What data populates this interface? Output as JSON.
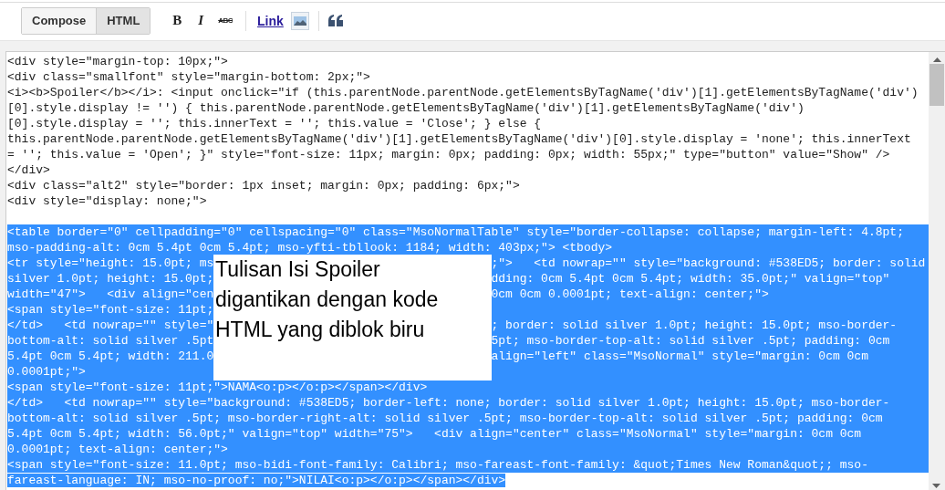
{
  "toolbar": {
    "mode_tabs": [
      {
        "label": "Compose",
        "selected": false
      },
      {
        "label": "HTML",
        "selected": true
      }
    ],
    "format_buttons": [
      {
        "label": "B",
        "kind": "bold"
      },
      {
        "label": "I",
        "kind": "italic"
      },
      {
        "label": "ABC",
        "kind": "strike"
      }
    ],
    "link": {
      "label": "Link"
    }
  },
  "editor": {
    "lines": [
      {
        "kind": "code",
        "text": "<div style=\"margin-top: 10px;\">",
        "selected": false
      },
      {
        "kind": "code",
        "text": "<div class=\"smallfont\" style=\"margin-bottom: 2px;\">",
        "selected": false
      },
      {
        "kind": "code",
        "text": "<i><b>Spoiler</b></i>: <input onclick=\"if (this.parentNode.parentNode.getElementsByTagName('div')[1].getElementsByTagName('div')",
        "selected": false
      },
      {
        "kind": "code",
        "text": "[0].style.display != '') { this.parentNode.parentNode.getElementsByTagName('div')[1].getElementsByTagName('div')",
        "selected": false
      },
      {
        "kind": "code",
        "text": "[0].style.display = ''; this.innerText = ''; this.value = 'Close'; } else {",
        "selected": false
      },
      {
        "kind": "code",
        "text": "this.parentNode.parentNode.getElementsByTagName('div')[1].getElementsByTagName('div')[0].style.display = 'none'; this.innerText",
        "selected": false
      },
      {
        "kind": "code",
        "text": "= ''; this.value = 'Open'; }\" style=\"font-size: 11px; margin: 0px; padding: 0px; width: 55px;\" type=\"button\" value=\"Show\" />",
        "selected": false
      },
      {
        "kind": "code",
        "text": "</div>",
        "selected": false
      },
      {
        "kind": "code",
        "text": "<div class=\"alt2\" style=\"border: 1px inset; margin: 0px; padding: 6px;\">",
        "selected": false
      },
      {
        "kind": "code",
        "text": "<div style=\"display: none;\">",
        "selected": false
      },
      {
        "kind": "blank"
      },
      {
        "kind": "code",
        "text": "<table border=\"0\" cellpadding=\"0\" cellspacing=\"0\" class=\"MsoNormalTable\" style=\"border-collapse: collapse; margin-left: 4.8pt;",
        "selected": true
      },
      {
        "kind": "code",
        "text": "mso-padding-alt: 0cm 5.4pt 0cm 5.4pt; mso-yfti-tbllook: 1184; width: 403px;\"> <tbody>",
        "selected": true
      },
      {
        "kind": "covered",
        "left": "<tr style=\"height: 15.0pt; ms",
        "right": ";\">   <td nowrap=\"\" style=\"background: #538ED5; border: solid",
        "selected": true
      },
      {
        "kind": "covered",
        "left": "silver 1.0pt; height: 15.0pt;",
        "right": "dding: 0cm 5.4pt 0cm 5.4pt; width: 35.0pt;\" valign=\"top\"",
        "selected": true
      },
      {
        "kind": "covered",
        "left": "width=\"47\">   <div align=\"cen",
        "right": "0cm 0cm 0.0001pt; text-align: center;\">",
        "selected": true
      },
      {
        "kind": "covered",
        "left": "<span style=\"font-size: 11pt;",
        "selected": true
      },
      {
        "kind": "covered",
        "left": "</td>   <td nowrap=\"\" style=\"",
        "right": "; border: solid silver 1.0pt; height: 15.0pt; mso-border-",
        "selected": true
      },
      {
        "kind": "covered",
        "left": "bottom-alt: solid silver .5pt",
        "right": "5pt; mso-border-top-alt: solid silver .5pt; padding: 0cm",
        "selected": true
      },
      {
        "kind": "covered",
        "left": "5.4pt 0cm 5.4pt; width: 211.0",
        "right": "align=\"left\" class=\"MsoNormal\" style=\"margin: 0cm 0cm",
        "selected": true
      },
      {
        "kind": "covered",
        "left": "0.0001pt;\">",
        "selected": true
      },
      {
        "kind": "code",
        "text": "<span style=\"font-size: 11pt;\">NAMA<o:p></o:p></span></div>",
        "selected": true
      },
      {
        "kind": "code",
        "text": "</td>   <td nowrap=\"\" style=\"background: #538ED5; border-left: none; border: solid silver 1.0pt; height: 15.0pt; mso-border-",
        "selected": true
      },
      {
        "kind": "code",
        "text": "bottom-alt: solid silver .5pt; mso-border-right-alt: solid silver .5pt; mso-border-top-alt: solid silver .5pt; padding: 0cm",
        "selected": true
      },
      {
        "kind": "code",
        "text": "5.4pt 0cm 5.4pt; width: 56.0pt;\" valign=\"top\" width=\"75\">   <div align=\"center\" class=\"MsoNormal\" style=\"margin: 0cm 0cm",
        "selected": true
      },
      {
        "kind": "code",
        "text": "0.0001pt; text-align: center;\">",
        "selected": true
      },
      {
        "kind": "code",
        "text": "<span style=\"font-size: 11.0pt; mso-bidi-font-family: Calibri; mso-fareast-font-family: &quot;Times New Roman&quot;; mso-",
        "selected": true
      },
      {
        "kind": "code",
        "text": "fareast-language: IN; mso-no-proof: no;\">NILAI<o:p></o:p></span></div>",
        "selected": true
      }
    ]
  },
  "overlay_note": {
    "lines": [
      "Tulisan Isi Spoiler",
      "digantikan dengan kode",
      "HTML yang diblok biru"
    ]
  }
}
